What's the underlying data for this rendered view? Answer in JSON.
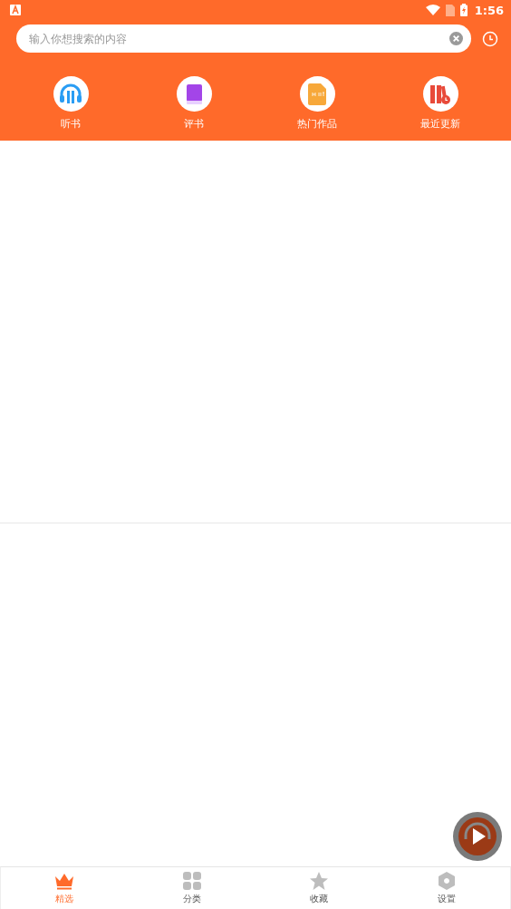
{
  "status_bar": {
    "time": "1:56"
  },
  "search": {
    "placeholder": "输入你想搜索的内容"
  },
  "categories": [
    {
      "label": "听书",
      "kind": "headphones"
    },
    {
      "label": "评书",
      "kind": "book"
    },
    {
      "label": "热门作品",
      "kind": "hot"
    },
    {
      "label": "最近更新",
      "kind": "shelf"
    }
  ],
  "nav": [
    {
      "label": "精选",
      "kind": "crown",
      "selected": true
    },
    {
      "label": "分类",
      "kind": "grid",
      "selected": false
    },
    {
      "label": "收藏",
      "kind": "star",
      "selected": false
    },
    {
      "label": "设置",
      "kind": "hex",
      "selected": false
    }
  ]
}
